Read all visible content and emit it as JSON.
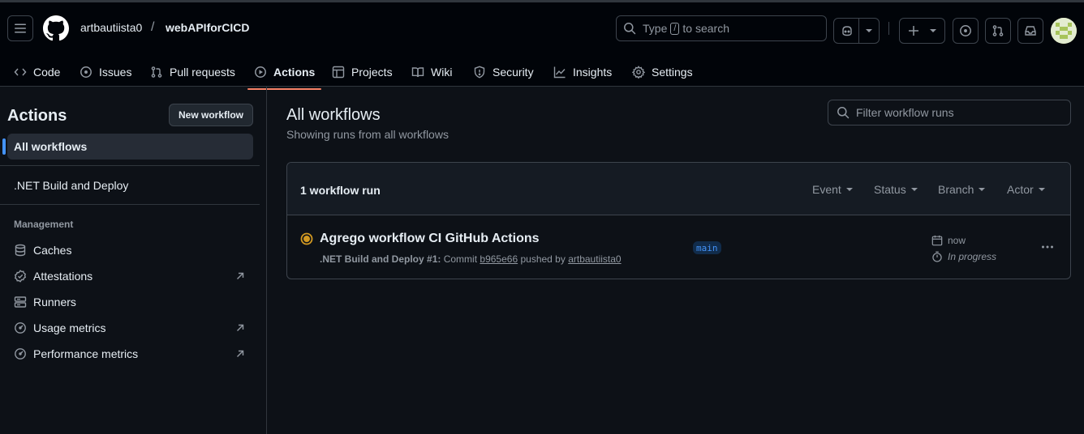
{
  "header": {
    "owner": "artbautiista0",
    "separator": "/",
    "repo": "webAPIforCICD",
    "search": {
      "before": "Type",
      "key": "/",
      "after": "to search"
    }
  },
  "tabs": [
    {
      "label": "Code",
      "icon": "code-icon"
    },
    {
      "label": "Issues",
      "icon": "issue-opened-icon"
    },
    {
      "label": "Pull requests",
      "icon": "git-pull-request-icon"
    },
    {
      "label": "Actions",
      "icon": "play-icon",
      "active": true
    },
    {
      "label": "Projects",
      "icon": "table-icon"
    },
    {
      "label": "Wiki",
      "icon": "book-icon"
    },
    {
      "label": "Security",
      "icon": "shield-icon"
    },
    {
      "label": "Insights",
      "icon": "graph-icon"
    },
    {
      "label": "Settings",
      "icon": "gear-icon"
    }
  ],
  "sidebar": {
    "title": "Actions",
    "new_workflow": "New workflow",
    "all_workflows": "All workflows",
    "workflows": [
      ".NET Build and Deploy"
    ],
    "management_heading": "Management",
    "management": [
      {
        "label": "Caches",
        "icon": "database-icon",
        "external": false
      },
      {
        "label": "Attestations",
        "icon": "verified-icon",
        "external": true
      },
      {
        "label": "Runners",
        "icon": "server-icon",
        "external": false
      },
      {
        "label": "Usage metrics",
        "icon": "meter-icon",
        "external": true
      },
      {
        "label": "Performance metrics",
        "icon": "meter-icon",
        "external": true
      }
    ]
  },
  "main": {
    "title": "All workflows",
    "subtitle": "Showing runs from all workflows",
    "filter_placeholder": "Filter workflow runs",
    "runs_count": "1 workflow run",
    "filters": [
      "Event",
      "Status",
      "Branch",
      "Actor"
    ],
    "run": {
      "title": "Agrego workflow CI GitHub Actions",
      "workflow": ".NET Build and Deploy",
      "run_number": "#1",
      "commit_prefix": "Commit",
      "commit": "b965e66",
      "pushed_by": "pushed by",
      "author": "artbautiista0",
      "branch": "main",
      "time": "now",
      "status": "In progress"
    }
  },
  "colors": {
    "accent": "#4493f8",
    "tab_underline": "#f78166",
    "in_progress": "#d29922"
  }
}
